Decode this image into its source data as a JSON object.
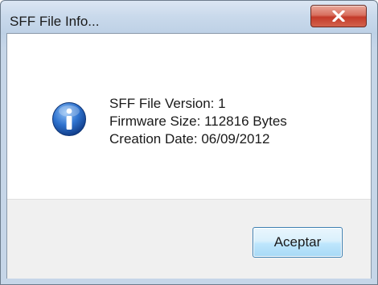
{
  "window": {
    "title": "SFF File Info..."
  },
  "message": {
    "line1": "SFF File Version: 1",
    "line2": "Firmware Size: 112816 Bytes",
    "line3": "Creation Date: 06/09/2012"
  },
  "buttons": {
    "ok_label": "Aceptar"
  },
  "icons": {
    "dialog_icon": "info-icon",
    "close_icon": "close-icon"
  },
  "colors": {
    "close_button": "#c43b2a",
    "info_icon": "#1f5fb8",
    "ok_button_border": "#3c7fb1"
  }
}
